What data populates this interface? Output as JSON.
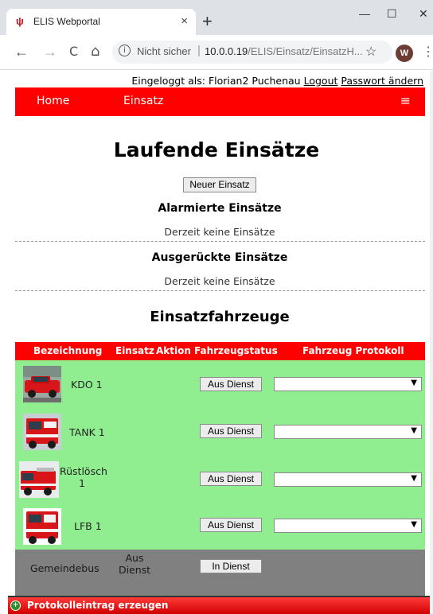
{
  "browser": {
    "tab_title": "ELIS Webportal",
    "tab_close": "×",
    "new_tab": "+",
    "minimize": "—",
    "maximize": "☐",
    "close": "✕",
    "back": "←",
    "forward": "→",
    "reload": "C",
    "home": "⌂",
    "info": "i",
    "not_secure": "Nicht sicher",
    "url_host": "10.0.0.19",
    "url_path": "/ELIS/Einsatz/EinsatzH...",
    "star": "☆",
    "profile_initial": "W",
    "menu": "⋮",
    "tab_icon_name": "elis-favicon-icon"
  },
  "header": {
    "logged_in_prefix": "Eingeloggt als: Florian2 Puchenau",
    "logout": "Logout",
    "change_password": "Passwort ändern"
  },
  "navbar": {
    "home": "Home",
    "einsatz": "Einsatz",
    "menu_icon": "≡"
  },
  "main": {
    "title": "Laufende Einsätze",
    "new_button": "Neuer Einsatz",
    "alarmed_title": "Alarmierte Einsätze",
    "alarmed_empty": "Derzeit keine Einsätze",
    "departed_title": "Ausgerückte Einsätze",
    "departed_empty": "Derzeit keine Einsätze",
    "vehicles_title": "Einsatzfahrzeuge"
  },
  "table": {
    "headers": [
      "Bezeichnung",
      "Einsatz",
      "Aktion",
      "Fahrzeugstatus",
      "Fahrzeug Protokoll"
    ],
    "rows": [
      {
        "name": "KDO 1",
        "status_button": "Aus Dienst",
        "protocol_value": "",
        "image": "kdo-vehicle-photo"
      },
      {
        "name": "TANK 1",
        "status_button": "Aus Dienst",
        "protocol_value": "",
        "image": "tank-vehicle-photo"
      },
      {
        "name": "Rüstlösch 1",
        "name_line1": "Rüstlösch",
        "name_line2": "1",
        "status_button": "Aus Dienst",
        "protocol_value": "",
        "image": "ruestloesch-vehicle-photo"
      },
      {
        "name": "LFB 1",
        "status_button": "Aus Dienst",
        "protocol_value": "",
        "image": "lfb-vehicle-photo"
      }
    ],
    "gray_row": {
      "name": "Gemeindebus",
      "einsatz_line1": "Aus",
      "einsatz_line2": "Dienst",
      "status_button": "In Dienst"
    }
  },
  "footer": {
    "label": "Protokolleintrag erzeugen",
    "icon": "+"
  },
  "colors": {
    "brand_red": "#ff0000",
    "available_green": "#90ee90",
    "out_of_service_gray": "#808080"
  }
}
